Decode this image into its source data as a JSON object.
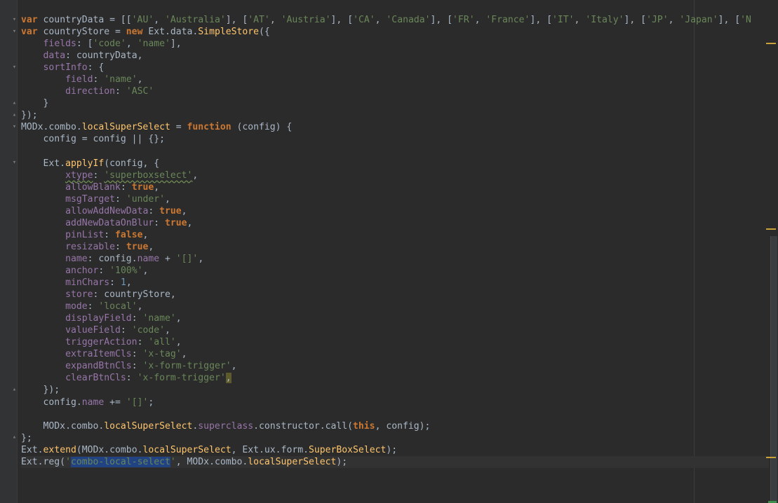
{
  "editor": {
    "language": "javascript",
    "lines": [
      [
        [
          "kw",
          "var"
        ],
        [
          "t",
          " countryData = [["
        ],
        [
          "str",
          "'AU'"
        ],
        [
          "t",
          ", "
        ],
        [
          "str",
          "'Australia'"
        ],
        [
          "t",
          "], ["
        ],
        [
          "str",
          "'AT'"
        ],
        [
          "t",
          ", "
        ],
        [
          "str",
          "'Austria'"
        ],
        [
          "t",
          "], ["
        ],
        [
          "str",
          "'CA'"
        ],
        [
          "t",
          ", "
        ],
        [
          "str",
          "'Canada'"
        ],
        [
          "t",
          "], ["
        ],
        [
          "str",
          "'FR'"
        ],
        [
          "t",
          ", "
        ],
        [
          "str",
          "'France'"
        ],
        [
          "t",
          "], ["
        ],
        [
          "str",
          "'IT'"
        ],
        [
          "t",
          ", "
        ],
        [
          "str",
          "'Italy'"
        ],
        [
          "t",
          "], ["
        ],
        [
          "str",
          "'JP'"
        ],
        [
          "t",
          ", "
        ],
        [
          "str",
          "'Japan'"
        ],
        [
          "t",
          "], ["
        ],
        [
          "str",
          "'N"
        ]
      ],
      [
        [
          "kw",
          "var"
        ],
        [
          "t",
          " countryStore = "
        ],
        [
          "kw",
          "new"
        ],
        [
          "t",
          " Ext.data."
        ],
        [
          "fn",
          "SimpleStore"
        ],
        [
          "t",
          "({"
        ]
      ],
      [
        [
          "t",
          "    "
        ],
        [
          "prop",
          "fields"
        ],
        [
          "t",
          ": ["
        ],
        [
          "str",
          "'code'"
        ],
        [
          "t",
          ", "
        ],
        [
          "str",
          "'name'"
        ],
        [
          "t",
          "],"
        ]
      ],
      [
        [
          "t",
          "    "
        ],
        [
          "prop",
          "data"
        ],
        [
          "t",
          ": countryData,"
        ]
      ],
      [
        [
          "t",
          "    "
        ],
        [
          "prop",
          "sortInfo"
        ],
        [
          "t",
          ": {"
        ]
      ],
      [
        [
          "t",
          "        "
        ],
        [
          "prop",
          "field"
        ],
        [
          "t",
          ": "
        ],
        [
          "str",
          "'name'"
        ],
        [
          "t",
          ","
        ]
      ],
      [
        [
          "t",
          "        "
        ],
        [
          "prop",
          "direction"
        ],
        [
          "t",
          ": "
        ],
        [
          "str",
          "'ASC'"
        ]
      ],
      [
        [
          "t",
          "    }"
        ]
      ],
      [
        [
          "t",
          "});"
        ]
      ],
      [
        [
          "t",
          "MODx.combo."
        ],
        [
          "fn",
          "localSuperSelect"
        ],
        [
          "t",
          " = "
        ],
        [
          "kw",
          "function"
        ],
        [
          "t",
          " (config) {"
        ]
      ],
      [
        [
          "t",
          "    config = config || {};"
        ]
      ],
      [
        [
          "t",
          ""
        ]
      ],
      [
        [
          "t",
          "    Ext."
        ],
        [
          "fn",
          "applyIf"
        ],
        [
          "t",
          "(config, {"
        ]
      ],
      [
        [
          "t",
          "        "
        ],
        [
          "propsq",
          "xtype"
        ],
        [
          "t",
          ": "
        ],
        [
          "strsq",
          "'superboxselect'"
        ],
        [
          "t",
          ","
        ]
      ],
      [
        [
          "t",
          "        "
        ],
        [
          "prop",
          "allowBlank"
        ],
        [
          "t",
          ": "
        ],
        [
          "kw",
          "true"
        ],
        [
          "t",
          ","
        ]
      ],
      [
        [
          "t",
          "        "
        ],
        [
          "prop",
          "msgTarget"
        ],
        [
          "t",
          ": "
        ],
        [
          "str",
          "'under'"
        ],
        [
          "t",
          ","
        ]
      ],
      [
        [
          "t",
          "        "
        ],
        [
          "prop",
          "allowAddNewData"
        ],
        [
          "t",
          ": "
        ],
        [
          "kw",
          "true"
        ],
        [
          "t",
          ","
        ]
      ],
      [
        [
          "t",
          "        "
        ],
        [
          "prop",
          "addNewDataOnBlur"
        ],
        [
          "t",
          ": "
        ],
        [
          "kw",
          "true"
        ],
        [
          "t",
          ","
        ]
      ],
      [
        [
          "t",
          "        "
        ],
        [
          "prop",
          "pinList"
        ],
        [
          "t",
          ": "
        ],
        [
          "kw",
          "false"
        ],
        [
          "t",
          ","
        ]
      ],
      [
        [
          "t",
          "        "
        ],
        [
          "prop",
          "resizable"
        ],
        [
          "t",
          ": "
        ],
        [
          "kw",
          "true"
        ],
        [
          "t",
          ","
        ]
      ],
      [
        [
          "t",
          "        "
        ],
        [
          "prop",
          "name"
        ],
        [
          "t",
          ": config."
        ],
        [
          "prop",
          "name"
        ],
        [
          "t",
          " + "
        ],
        [
          "str",
          "'[]'"
        ],
        [
          "t",
          ","
        ]
      ],
      [
        [
          "t",
          "        "
        ],
        [
          "prop",
          "anchor"
        ],
        [
          "t",
          ": "
        ],
        [
          "str",
          "'100%'"
        ],
        [
          "t",
          ","
        ]
      ],
      [
        [
          "t",
          "        "
        ],
        [
          "prop",
          "minChars"
        ],
        [
          "t",
          ": "
        ],
        [
          "num",
          "1"
        ],
        [
          "t",
          ","
        ]
      ],
      [
        [
          "t",
          "        "
        ],
        [
          "prop",
          "store"
        ],
        [
          "t",
          ": countryStore,"
        ]
      ],
      [
        [
          "t",
          "        "
        ],
        [
          "prop",
          "mode"
        ],
        [
          "t",
          ": "
        ],
        [
          "str",
          "'local'"
        ],
        [
          "t",
          ","
        ]
      ],
      [
        [
          "t",
          "        "
        ],
        [
          "prop",
          "displayField"
        ],
        [
          "t",
          ": "
        ],
        [
          "str",
          "'name'"
        ],
        [
          "t",
          ","
        ]
      ],
      [
        [
          "t",
          "        "
        ],
        [
          "prop",
          "valueField"
        ],
        [
          "t",
          ": "
        ],
        [
          "str",
          "'code'"
        ],
        [
          "t",
          ","
        ]
      ],
      [
        [
          "t",
          "        "
        ],
        [
          "prop",
          "triggerAction"
        ],
        [
          "t",
          ": "
        ],
        [
          "str",
          "'all'"
        ],
        [
          "t",
          ","
        ]
      ],
      [
        [
          "t",
          "        "
        ],
        [
          "prop",
          "extraItemCls"
        ],
        [
          "t",
          ": "
        ],
        [
          "str",
          "'x-tag'"
        ],
        [
          "t",
          ","
        ]
      ],
      [
        [
          "t",
          "        "
        ],
        [
          "prop",
          "expandBtnCls"
        ],
        [
          "t",
          ": "
        ],
        [
          "str",
          "'x-form-trigger'"
        ],
        [
          "t",
          ","
        ]
      ],
      [
        [
          "t",
          "        "
        ],
        [
          "prop",
          "clearBtnCls"
        ],
        [
          "t",
          ": "
        ],
        [
          "str",
          "'x-form-trigger'"
        ],
        [
          "mark",
          ","
        ]
      ],
      [
        [
          "t",
          "    });"
        ]
      ],
      [
        [
          "t",
          "    config."
        ],
        [
          "prop",
          "name"
        ],
        [
          "t",
          " += "
        ],
        [
          "str",
          "'[]'"
        ],
        [
          "t",
          ";"
        ]
      ],
      [
        [
          "t",
          ""
        ]
      ],
      [
        [
          "t",
          "    MODx.combo."
        ],
        [
          "fn",
          "localSuperSelect"
        ],
        [
          "t",
          "."
        ],
        [
          "prop",
          "superclass"
        ],
        [
          "t",
          ".constructor.call("
        ],
        [
          "kw",
          "this"
        ],
        [
          "t",
          ", config);"
        ]
      ],
      [
        [
          "t",
          "};"
        ]
      ],
      [
        [
          "t",
          "Ext."
        ],
        [
          "fn",
          "extend"
        ],
        [
          "t",
          "(MODx.combo."
        ],
        [
          "fn",
          "localSuperSelect"
        ],
        [
          "t",
          ", Ext.ux.form."
        ],
        [
          "fn",
          "SuperBoxSelect"
        ],
        [
          "t",
          ");"
        ]
      ],
      [
        [
          "t",
          "Ext.reg("
        ],
        [
          "str",
          "'"
        ],
        [
          "selstr",
          "combo-local-select"
        ],
        [
          "str",
          "'"
        ],
        [
          "t",
          ", MODx.combo."
        ],
        [
          "fn",
          "localSuperSelect"
        ],
        [
          "t",
          ");"
        ]
      ]
    ],
    "current_line": 38
  }
}
